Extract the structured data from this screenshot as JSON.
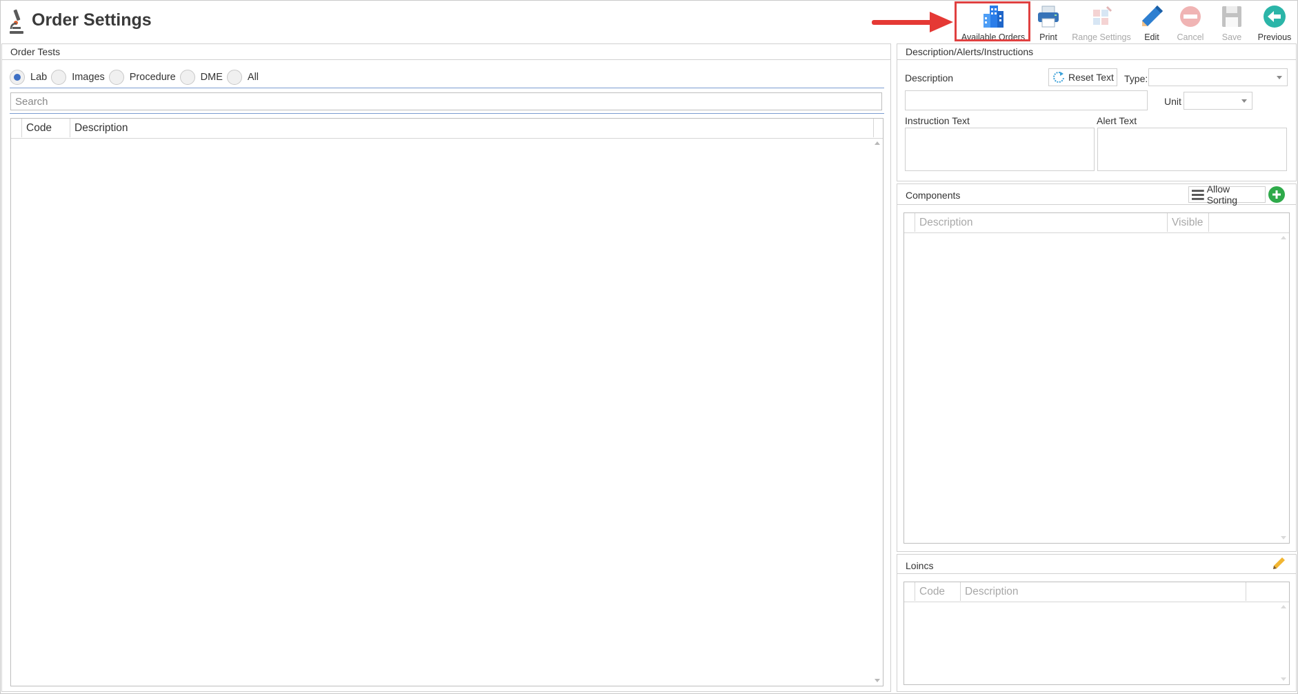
{
  "window": {
    "title": "Order Settings"
  },
  "toolbar": {
    "buttons": [
      {
        "label": "Available Orders",
        "icon": "building-icon",
        "enabled": true,
        "highlighted": true
      },
      {
        "label": "Print",
        "icon": "printer-icon",
        "enabled": true
      },
      {
        "label": "Range Settings",
        "icon": "range-settings-icon",
        "enabled": false
      },
      {
        "label": "Edit",
        "icon": "pencil-icon",
        "enabled": true
      },
      {
        "label": "Cancel",
        "icon": "cancel-icon",
        "enabled": false
      },
      {
        "label": "Save",
        "icon": "floppy-icon",
        "enabled": false
      },
      {
        "label": "Previous",
        "icon": "back-arrow-icon",
        "enabled": true
      }
    ]
  },
  "order_tests": {
    "header": "Order Tests",
    "filters": [
      {
        "label": "Lab",
        "checked": true
      },
      {
        "label": "Images",
        "checked": false
      },
      {
        "label": "Procedure",
        "checked": false
      },
      {
        "label": "DME",
        "checked": false
      },
      {
        "label": "All",
        "checked": false
      }
    ],
    "search": {
      "placeholder": "Search",
      "value": ""
    },
    "columns": [
      "Code",
      "Description"
    ],
    "rows": []
  },
  "description_panel": {
    "header": "Description/Alerts/Instructions",
    "description_label": "Description",
    "reset_button": "Reset Text",
    "type_label": "Type:",
    "type_value": "",
    "unit_label": "Unit",
    "unit_value": "",
    "description_value": "",
    "instruction_label": "Instruction Text",
    "instruction_value": "",
    "alert_label": "Alert Text",
    "alert_value": ""
  },
  "components": {
    "header": "Components",
    "sort_button": "Allow Sorting",
    "columns": [
      "Description",
      "Visible"
    ],
    "rows": []
  },
  "loincs": {
    "header": "Loincs",
    "columns": [
      "Code",
      "Description"
    ],
    "rows": []
  },
  "colors": {
    "accent": "#3d6fc4",
    "highlight_border": "#e04040",
    "add_button": "#2eaa4a",
    "edit_pencil": "#2e7fd0"
  }
}
